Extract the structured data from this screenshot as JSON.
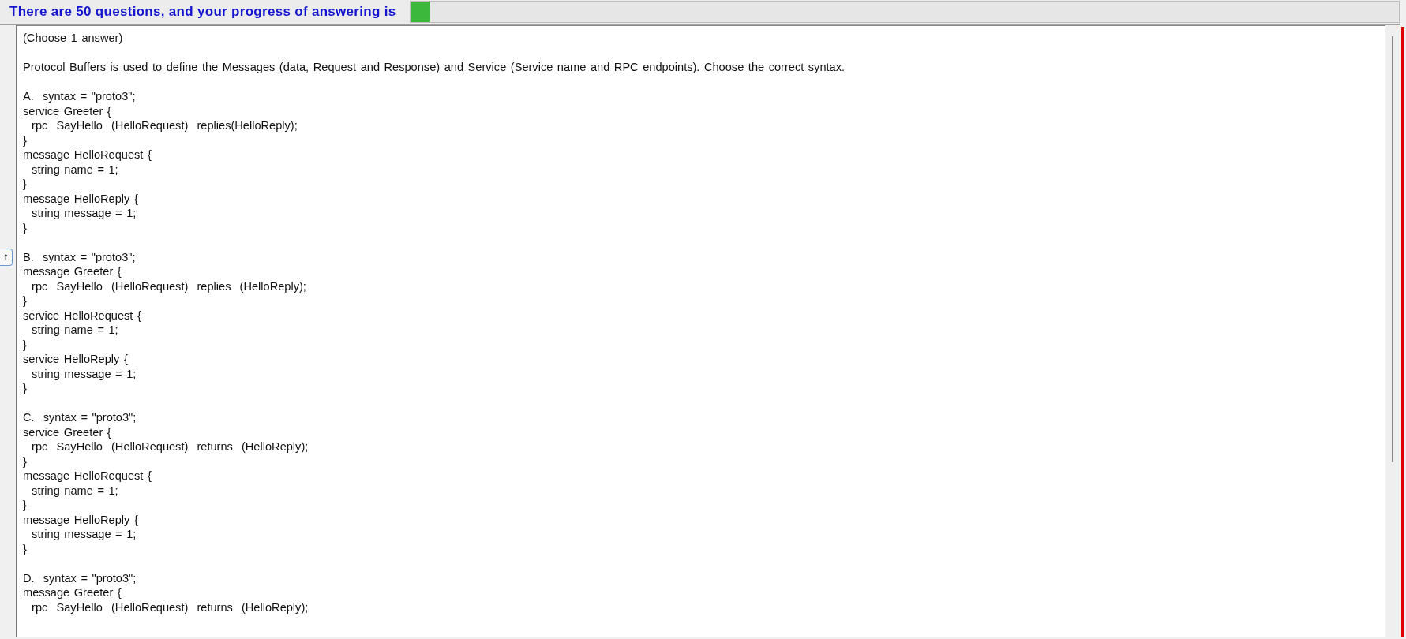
{
  "header": {
    "text": "There are 50 questions, and your progress of answering is",
    "progress": {
      "level": 0.02
    }
  },
  "side_button": {
    "label": "t"
  },
  "question": {
    "instruction": "(Choose 1 answer)",
    "prompt": "Protocol Buffers is used to define the Messages (data, Request and Response) and Service (Service name and RPC endpoints). Choose the correct syntax.",
    "options": [
      {
        "label": "A.",
        "lines": [
          "syntax = \"proto3\";",
          "service Greeter {",
          "  rpc  SayHello  (HelloRequest)  replies(HelloReply);",
          "}",
          "message HelloRequest {",
          "  string name = 1;",
          "}",
          "message HelloReply {",
          "  string message = 1;",
          "}"
        ]
      },
      {
        "label": "B.",
        "lines": [
          "syntax = \"proto3\";",
          "message Greeter {",
          "  rpc  SayHello  (HelloRequest)  replies  (HelloReply);",
          "}",
          "service HelloRequest {",
          "  string name = 1;",
          "}",
          "service HelloReply {",
          "  string message = 1;",
          "}"
        ]
      },
      {
        "label": "C.",
        "lines": [
          "syntax = \"proto3\";",
          "service Greeter {",
          "  rpc  SayHello  (HelloRequest)  returns  (HelloReply);",
          "}",
          "message HelloRequest {",
          "  string name = 1;",
          "}",
          "message HelloReply {",
          "  string message = 1;",
          "}"
        ]
      },
      {
        "label": "D.",
        "lines": [
          "syntax = \"proto3\";",
          "message Greeter {",
          "  rpc  SayHello  (HelloRequest)  returns  (HelloReply);"
        ]
      }
    ]
  }
}
